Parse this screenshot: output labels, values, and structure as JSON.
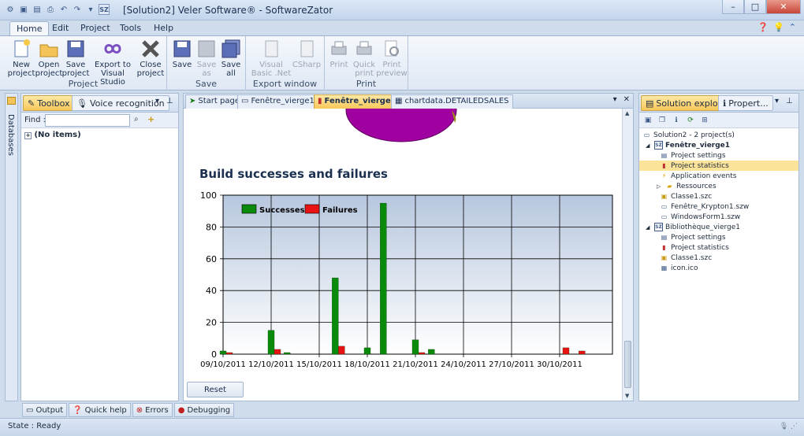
{
  "window": {
    "title": "[Solution2] Veler Software® - SoftwareZator"
  },
  "ribbon_tabs": [
    "Home",
    "Edit",
    "Project",
    "Tools",
    "Help"
  ],
  "ribbon": {
    "project": {
      "label": "Project",
      "new": "New project",
      "open": "Open project",
      "save": "Save project",
      "export": "Export to Visual Studio",
      "close": "Close project"
    },
    "save": {
      "label": "Save",
      "save": "Save",
      "save_as": "Save as",
      "save_all": "Save all"
    },
    "export_window": {
      "label": "Export window",
      "vb": "Visual Basic .Net",
      "csharp": "CSharp"
    },
    "print": {
      "label": "Print",
      "print": "Print",
      "quick_print": "Quick print",
      "print_preview": "Print preview"
    }
  },
  "left_panel": {
    "side_label": "Databases",
    "tabs": [
      "Toolbox",
      "Voice recognition"
    ],
    "find_label": "Find :",
    "find_value": "",
    "no_items": "(No items)"
  },
  "doc_tabs": [
    "Start page",
    "Fenêtre_vierge1*",
    "Fenêtre_vierge1",
    "chartdata.DETAILEDSALES"
  ],
  "doc": {
    "reset": "Reset"
  },
  "chart_data": {
    "type": "bar",
    "title": "Build successes and failures",
    "x_tick_labels": [
      "09/10/2011",
      "12/10/2011",
      "15/10/2011",
      "18/10/2011",
      "21/10/2011",
      "24/10/2011",
      "27/10/2011",
      "30/10/2011"
    ],
    "ylim": [
      0,
      100
    ],
    "yticks": [
      0,
      20,
      40,
      60,
      80,
      100
    ],
    "grid": true,
    "legend": "top-left",
    "dates": [
      "09/10/2011",
      "12/10/2011",
      "13/10/2011",
      "16/10/2011",
      "18/10/2011",
      "19/10/2011",
      "21/10/2011",
      "22/10/2011",
      "30/10/2011",
      "31/10/2011"
    ],
    "series": [
      {
        "name": "Successes",
        "color": "#0a8a0a",
        "values": [
          2,
          15,
          1,
          48,
          4,
          95,
          9,
          3,
          0,
          0
        ]
      },
      {
        "name": "Failures",
        "color": "#e81212",
        "values": [
          1,
          3,
          0,
          5,
          0,
          0,
          1,
          0,
          4,
          2
        ]
      }
    ]
  },
  "right_panel": {
    "tabs": [
      "Solution explo...",
      "Propert..."
    ],
    "tree": [
      {
        "label": "Solution2 - 2 project(s)",
        "level": 0,
        "icon": "solution-icon"
      },
      {
        "label": "Fenêtre_vierge1",
        "level": 1,
        "icon": "project-icon",
        "bold": true,
        "expanded": true
      },
      {
        "label": "Project settings",
        "level": 2,
        "icon": "settings-icon"
      },
      {
        "label": "Project statistics",
        "level": 2,
        "icon": "statistics-icon",
        "selected": true
      },
      {
        "label": "Application events",
        "level": 2,
        "icon": "events-icon"
      },
      {
        "label": "Ressources",
        "level": 2,
        "icon": "folder-icon",
        "collapsed": true
      },
      {
        "label": "Classe1.szc",
        "level": 2,
        "icon": "class-icon"
      },
      {
        "label": "Fenêtre_Krypton1.szw",
        "level": 2,
        "icon": "window-icon"
      },
      {
        "label": "WindowsForm1.szw",
        "level": 2,
        "icon": "window-icon"
      },
      {
        "label": "Bibliothèque_vierge1",
        "level": 1,
        "icon": "project-icon",
        "expanded": true
      },
      {
        "label": "Project settings",
        "level": 2,
        "icon": "settings-icon"
      },
      {
        "label": "Project statistics",
        "level": 2,
        "icon": "statistics-icon"
      },
      {
        "label": "Classe1.szc",
        "level": 2,
        "icon": "class-icon"
      },
      {
        "label": "icon.ico",
        "level": 2,
        "icon": "file-icon"
      }
    ]
  },
  "bottom_tabs": [
    "Output",
    "Quick help",
    "Errors",
    "Debugging"
  ],
  "status": {
    "label": "State :",
    "value": "Ready"
  }
}
